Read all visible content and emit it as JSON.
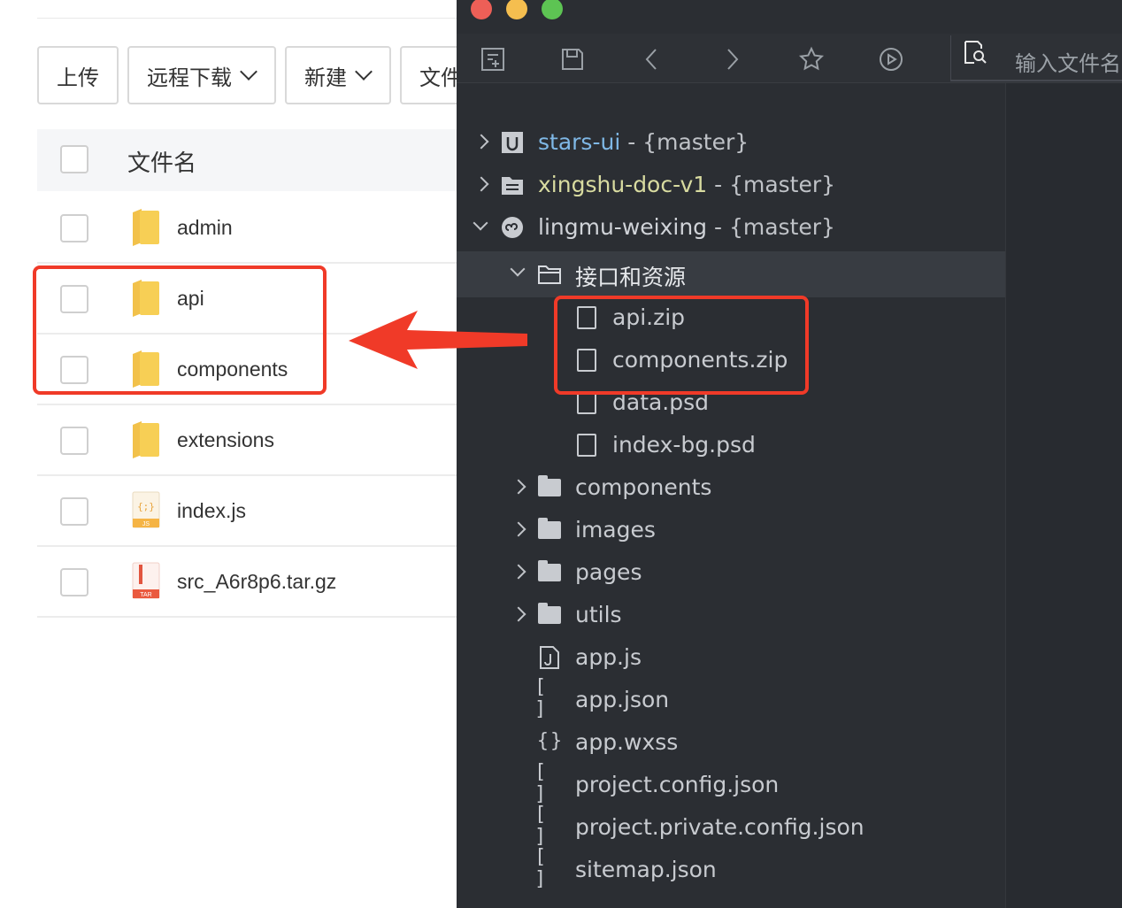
{
  "file_manager": {
    "toolbar": {
      "upload_label": "上传",
      "remote_download_label": "远程下载",
      "new_label": "新建",
      "file_label": "文件"
    },
    "table_header": {
      "filename_label": "文件名"
    },
    "rows": [
      {
        "name": "admin",
        "type": "folder"
      },
      {
        "name": "api",
        "type": "folder"
      },
      {
        "name": "components",
        "type": "folder"
      },
      {
        "name": "extensions",
        "type": "folder"
      },
      {
        "name": "index.js",
        "type": "js-file",
        "badge": "JS"
      },
      {
        "name": "src_A6r8p6.tar.gz",
        "type": "tar-file",
        "badge": "TAR"
      }
    ]
  },
  "editor": {
    "search_placeholder": "输入文件名",
    "toolbar_icons": [
      "new-file-icon",
      "save-icon",
      "back-icon",
      "forward-icon",
      "star-icon",
      "play-icon",
      "find-file-icon"
    ],
    "projects": [
      {
        "name": "stars-ui",
        "branch": "- {master}"
      },
      {
        "name": "xingshu-doc-v1",
        "branch": "- {master}"
      },
      {
        "name": "lingmu-weixing",
        "branch": "- {master}"
      }
    ],
    "tree": {
      "open_folder": "接口和资源",
      "resource_files": [
        "api.zip",
        "components.zip",
        "data.psd",
        "index-bg.psd"
      ],
      "folders": [
        "components",
        "images",
        "pages",
        "utils"
      ],
      "files": [
        {
          "name": "app.js",
          "icon": "js-file-icon"
        },
        {
          "name": "app.json",
          "icon": "[ ]"
        },
        {
          "name": "app.wxss",
          "icon": "{}"
        },
        {
          "name": "project.config.json",
          "icon": "[ ]"
        },
        {
          "name": "project.private.config.json",
          "icon": "[ ]"
        },
        {
          "name": "sitemap.json",
          "icon": "[ ]"
        }
      ]
    }
  },
  "colors": {
    "highlight_red": "#f03a28",
    "editor_bg": "#2b2e33",
    "folder_yellow": "#f7cf55"
  }
}
